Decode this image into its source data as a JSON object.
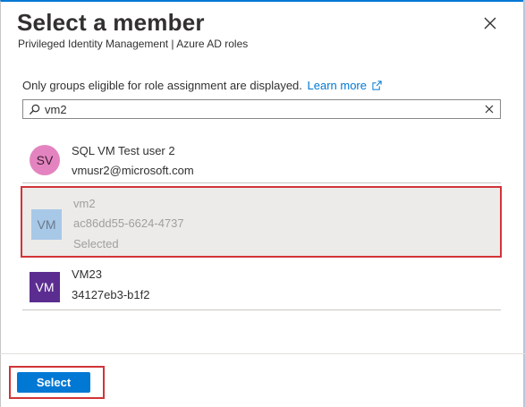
{
  "header": {
    "title": "Select a member",
    "subtitle": "Privileged Identity Management | Azure AD roles"
  },
  "info": {
    "text": "Only groups eligible for role assignment are displayed.",
    "link": "Learn more"
  },
  "search": {
    "value": "vm2"
  },
  "results": [
    {
      "initials": "SV",
      "name": "SQL VM Test user 2",
      "detail": "vmusr2@microsoft.com",
      "color": "#e384c0"
    },
    {
      "initials": "VM",
      "name": "vm2",
      "detail": "ac86dd55-6624-4737",
      "status": "Selected",
      "color": "#a8c8e8"
    },
    {
      "initials": "VM",
      "name": "VM23",
      "detail": "34127eb3-b1f2",
      "color": "#5c2d91"
    }
  ],
  "footer": {
    "select_label": "Select"
  },
  "colors": {
    "accent": "#0078d4",
    "highlight": "#d13438"
  }
}
